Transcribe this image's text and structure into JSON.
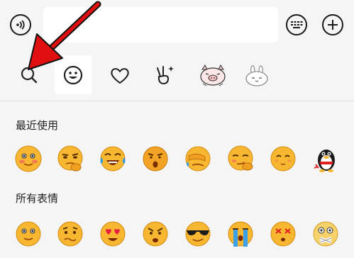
{
  "input": {
    "value": "",
    "placeholder": ""
  },
  "sections": {
    "recent": {
      "title": "最近使用"
    },
    "all": {
      "title": "所有表情"
    }
  },
  "icons": {
    "voice": "voice-icon",
    "keyboard": "keyboard-icon",
    "plus": "plus-icon",
    "search": "search-icon",
    "emoji_tab": "smiley-icon",
    "favorites": "heart-icon",
    "gesture": "victory-hand-icon",
    "sticker_pig": "pig-sticker-icon",
    "sticker_bunny": "bunny-sticker-icon"
  },
  "colors": {
    "background": "#f5f5f5",
    "accent_arrow": "#e01010",
    "emoji_yellow": "#f7b731"
  }
}
